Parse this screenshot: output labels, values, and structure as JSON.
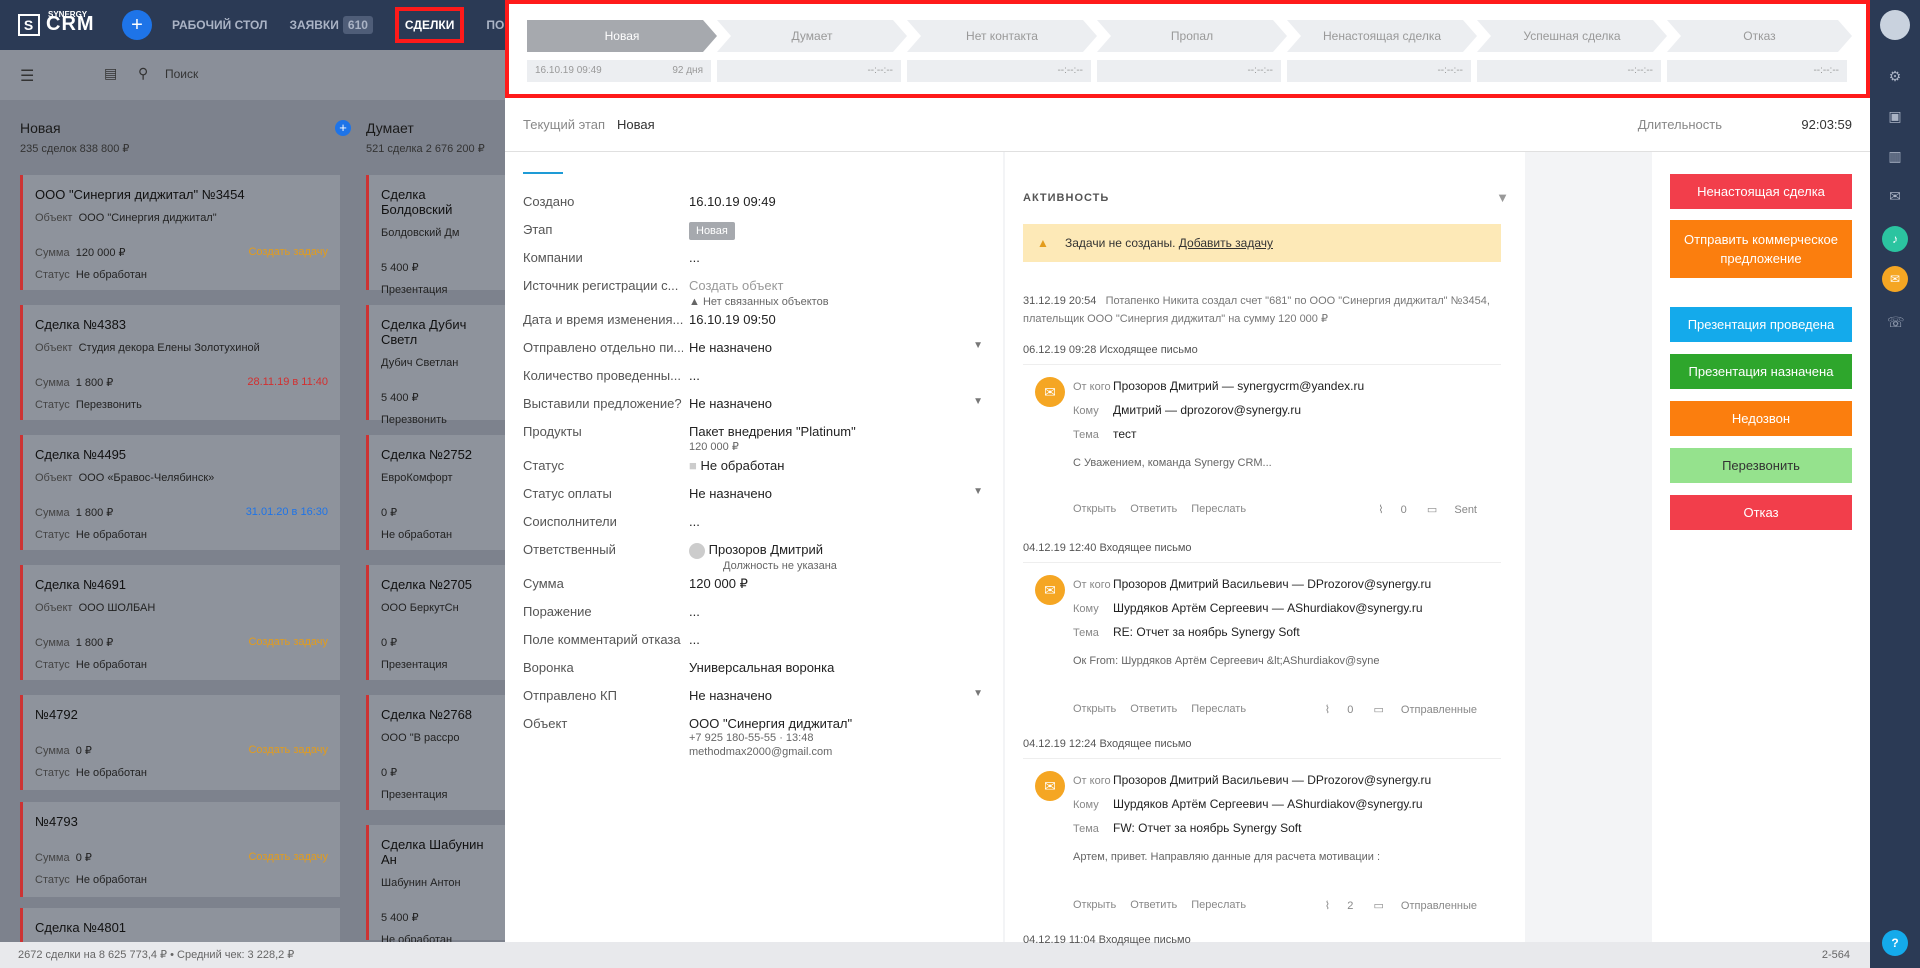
{
  "topbar": {
    "logo_small": "SYNERGY",
    "logo": "CRM",
    "nav": [
      {
        "label": "РАБОЧИЙ СТОЛ"
      },
      {
        "label": "ЗАЯВКИ",
        "count": "610"
      },
      {
        "label": "СДЕЛКИ"
      },
      {
        "label": "ПОРУЧЕН"
      }
    ]
  },
  "search": {
    "placeholder": "Поиск"
  },
  "columns": [
    {
      "title": "Новая",
      "sub": "235 сделок   838 800 ₽"
    },
    {
      "title": "Думает",
      "sub": "521 сделка   2 676 200 ₽"
    }
  ],
  "cards": [
    {
      "title": "ООО \"Синергия диджитал\" №3454",
      "obj_label": "Объект",
      "obj": "ООО \"Синергия диджитал\"",
      "sum_label": "Сумма",
      "sum": "120 000 ₽",
      "status_label": "Статус",
      "status": "Не обработан",
      "action": "Создать задачу"
    },
    {
      "title": "Сделка  №4383",
      "obj_label": "Объект",
      "obj": "Студия декора Елены Золотухиной",
      "sum_label": "Сумма",
      "sum": "1 800 ₽",
      "status_label": "Статус",
      "status": "Перезвонить",
      "action": "28.11.19 в 11:40"
    },
    {
      "title": "Сделка  №4495",
      "obj_label": "Объект",
      "obj": "ООО «Бравос-Челябинск»",
      "sum_label": "Сумма",
      "sum": "1 800 ₽",
      "status_label": "Статус",
      "status": "Не обработан",
      "action": "31.01.20 в 16:30"
    },
    {
      "title": "Сделка  №4691",
      "obj_label": "Объект",
      "obj": "ООО ШОЛБАН",
      "sum_label": "Сумма",
      "sum": "1 800 ₽",
      "status_label": "Статус",
      "status": "Не обработан",
      "action": "Создать задачу"
    },
    {
      "title": "№4792",
      "sum_label": "Сумма",
      "sum": "0 ₽",
      "status_label": "Статус",
      "status": "Не обработан",
      "action": "Создать задачу"
    },
    {
      "title": "№4793",
      "sum_label": "Сумма",
      "sum": "0 ₽",
      "status_label": "Статус",
      "status": "Не обработан",
      "action": "Создать задачу"
    },
    {
      "title": "Сделка  №4801"
    }
  ],
  "cards2": [
    {
      "title": "Сделка Болдовский",
      "obj": "Болдовский Дм",
      "sum": "5 400 ₽",
      "status": "Презентация"
    },
    {
      "title": "Сделка Дубич Светл",
      "obj": "Дубич Светлан",
      "sum": "5 400 ₽",
      "status": "Перезвонить"
    },
    {
      "title": "Сделка  №2752",
      "obj": "ЕвроКомфорт",
      "sum": "0 ₽",
      "status": "Не обработан"
    },
    {
      "title": "Сделка  №2705",
      "obj": "ООО БеркутСн",
      "sum": "0 ₽",
      "status": "Презентация"
    },
    {
      "title": "Сделка  №2768",
      "obj": "ООО \"В рассро",
      "sum": "0 ₽",
      "status": "Презентация"
    },
    {
      "title": "Сделка Шабунин Ан",
      "obj": "Шабунин Антон",
      "sum": "5 400 ₽",
      "status": "Не обработан"
    }
  ],
  "footer": {
    "total": "2672 сделки на 8 625 773,4 ₽   •   Средний чек: 3 228,2 ₽",
    "page": "2-564"
  },
  "stages": [
    {
      "name": "Новая",
      "date": "16.10.19 09:49",
      "days": "92 дня"
    },
    {
      "name": "Думает",
      "date": "--:--:--"
    },
    {
      "name": "Нет контакта",
      "date": "--:--:--"
    },
    {
      "name": "Пропал",
      "date": "--:--:--"
    },
    {
      "name": "Ненастоящая сделка",
      "date": "--:--:--"
    },
    {
      "name": "Успешная сделка",
      "date": "--:--:--"
    },
    {
      "name": "Отказ",
      "date": "--:--:--"
    }
  ],
  "current": {
    "label": "Текущий этап",
    "value": "Новая",
    "dur_label": "Длительность",
    "dur": "92:03:59"
  },
  "fields": [
    {
      "k": "Создано",
      "v": "16.10.19 09:49"
    },
    {
      "k": "Этап",
      "v": "Новая"
    },
    {
      "k": "Компании",
      "v": "..."
    },
    {
      "k": "Источник регистрации с...",
      "v": "Создать объект",
      "note": "Нет связанных объектов"
    },
    {
      "k": "Дата и время изменения...",
      "v": "16.10.19 09:50"
    },
    {
      "k": "Отправлено отдельно пи...",
      "v": "Не назначено"
    },
    {
      "k": "Количество проведенны...",
      "v": "..."
    },
    {
      "k": "Выставили предложение?",
      "v": "Не назначено"
    },
    {
      "k": "Продукты",
      "v": "Пакет внедрения \"Platinum\"",
      "note": "120 000 ₽"
    },
    {
      "k": "Статус",
      "v": "Не обработан"
    },
    {
      "k": "Статус оплаты",
      "v": "Не назначено"
    },
    {
      "k": "Соисполнители",
      "v": "..."
    },
    {
      "k": "Ответственный",
      "v": "Прозоров Дмитрий",
      "note": "Должность не указана"
    },
    {
      "k": "Сумма",
      "v": "120 000 ₽"
    },
    {
      "k": "Поражение",
      "v": "..."
    },
    {
      "k": "Поле комментарий отказа",
      "v": "..."
    },
    {
      "k": "Воронка",
      "v": "Универсальная воронка"
    },
    {
      "k": "Отправлено КП",
      "v": "Не назначено"
    },
    {
      "k": "Объект",
      "v": "ООО \"Синергия диджитал\"",
      "note": "+7 925 180-55-55 · 13:48",
      "note2": "methodmax2000@gmail.com"
    }
  ],
  "activity": {
    "title": "АКТИВНОСТЬ",
    "warn": "Задачи не созданы.",
    "warn_link": "Добавить задачу",
    "e1_time": "31.12.19 20:54",
    "e1_text": "Потапенко Никита создал счет \"681\" по ООО \"Синергия диджитал\" №3454, плательщик ООО \"Синергия диджитал\" на сумму 120 000 ₽",
    "mails": [
      {
        "hdr": "06.12.19 09:28   Исходящее письмо",
        "from_k": "От кого",
        "from": "Прозоров Дмитрий — synergycrm@yandex.ru",
        "to_k": "Кому",
        "to": "Дмитрий — dprozorov@synergy.ru",
        "subj_k": "Тема",
        "subj": "тест",
        "body": "С Уважением, команда Synergy CRM...",
        "a1": "Открыть",
        "a2": "Ответить",
        "a3": "Переслать",
        "att": "0",
        "folder": "Sent"
      },
      {
        "hdr": "04.12.19 12:40   Входящее письмо",
        "from_k": "От кого",
        "from": "Прозоров Дмитрий Васильевич — DProzorov@synergy.ru",
        "to_k": "Кому",
        "to": "Шурдяков Артём Сергеевич — AShurdiakov@synergy.ru",
        "subj_k": "Тема",
        "subj": "RE: Отчет за ноябрь Synergy Soft",
        "body": "Ок From: Шурдяков Артём Сергеевич &lt;AShurdiakov@syne",
        "a1": "Открыть",
        "a2": "Ответить",
        "a3": "Переслать",
        "att": "0",
        "folder": "Отправленные"
      },
      {
        "hdr": "04.12.19 12:24   Входящее письмо",
        "from_k": "От кого",
        "from": "Прозоров Дмитрий Васильевич — DProzorov@synergy.ru",
        "to_k": "Кому",
        "to": "Шурдяков Артём Сергеевич — AShurdiakov@synergy.ru",
        "subj_k": "Тема",
        "subj": "FW: Отчет за ноябрь Synergy Soft",
        "body": "Артем, привет. Направляю данные для расчета мотивации :",
        "a1": "Открыть",
        "a2": "Ответить",
        "a3": "Переслать",
        "att": "2",
        "folder": "Отправленные"
      }
    ],
    "last": "04.12.19 11:04   Входящее письмо"
  },
  "buttons": [
    {
      "label": "Ненастоящая сделка",
      "color": "#f23e4b"
    },
    {
      "label": "Отправить коммерческое предложение",
      "color": "#fb7e0e"
    },
    {
      "label": "Презентация проведена",
      "color": "#14aaeb"
    },
    {
      "label": "Презентация назначена",
      "color": "#2ea62c"
    },
    {
      "label": "Недозвон",
      "color": "#fb7e0e"
    },
    {
      "label": "Перезвонить",
      "color": "#95e28d"
    },
    {
      "label": "Отказ",
      "color": "#f23e4b"
    }
  ]
}
